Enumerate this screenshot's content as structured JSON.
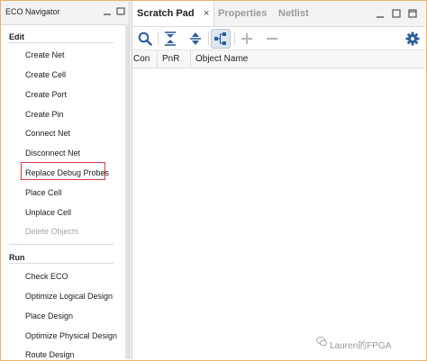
{
  "eco_navigator": {
    "title": "ECO Navigator",
    "sections": [
      {
        "label": "Edit",
        "items": [
          {
            "label": "Create Net",
            "enabled": true
          },
          {
            "label": "Create Cell",
            "enabled": true
          },
          {
            "label": "Create Port",
            "enabled": true
          },
          {
            "label": "Create Pin",
            "enabled": true
          },
          {
            "label": "Connect Net",
            "enabled": true
          },
          {
            "label": "Disconnect Net",
            "enabled": true
          },
          {
            "label": "Replace Debug Probes",
            "enabled": true,
            "highlighted": true
          },
          {
            "label": "Place Cell",
            "enabled": true
          },
          {
            "label": "Unplace Cell",
            "enabled": true
          },
          {
            "label": "Delete Objects",
            "enabled": false
          }
        ]
      },
      {
        "label": "Run",
        "items": [
          {
            "label": "Check ECO",
            "enabled": true
          },
          {
            "label": "Optimize Logical Design",
            "enabled": true
          },
          {
            "label": "Place Design",
            "enabled": true
          },
          {
            "label": "Optimize Physical Design",
            "enabled": true
          },
          {
            "label": "Route Design",
            "enabled": true
          }
        ]
      }
    ]
  },
  "tabs": [
    {
      "label": "Scratch Pad",
      "active": true,
      "close": "×"
    },
    {
      "label": "Properties",
      "active": false
    },
    {
      "label": "Netlist",
      "active": false
    }
  ],
  "toolbar_icons": [
    "search-icon",
    "collapse-all-icon",
    "expand-all-icon",
    "hierarchy-icon",
    "add-icon",
    "remove-icon",
    "settings-icon"
  ],
  "table": {
    "columns": [
      "Con",
      "PnR",
      "Object Name"
    ]
  },
  "watermark": "Lauren的FPGA",
  "colors": {
    "highlight_box": "#d43a3a",
    "icon_blue": "#2a5d9b",
    "frame": "#e8b16a"
  }
}
